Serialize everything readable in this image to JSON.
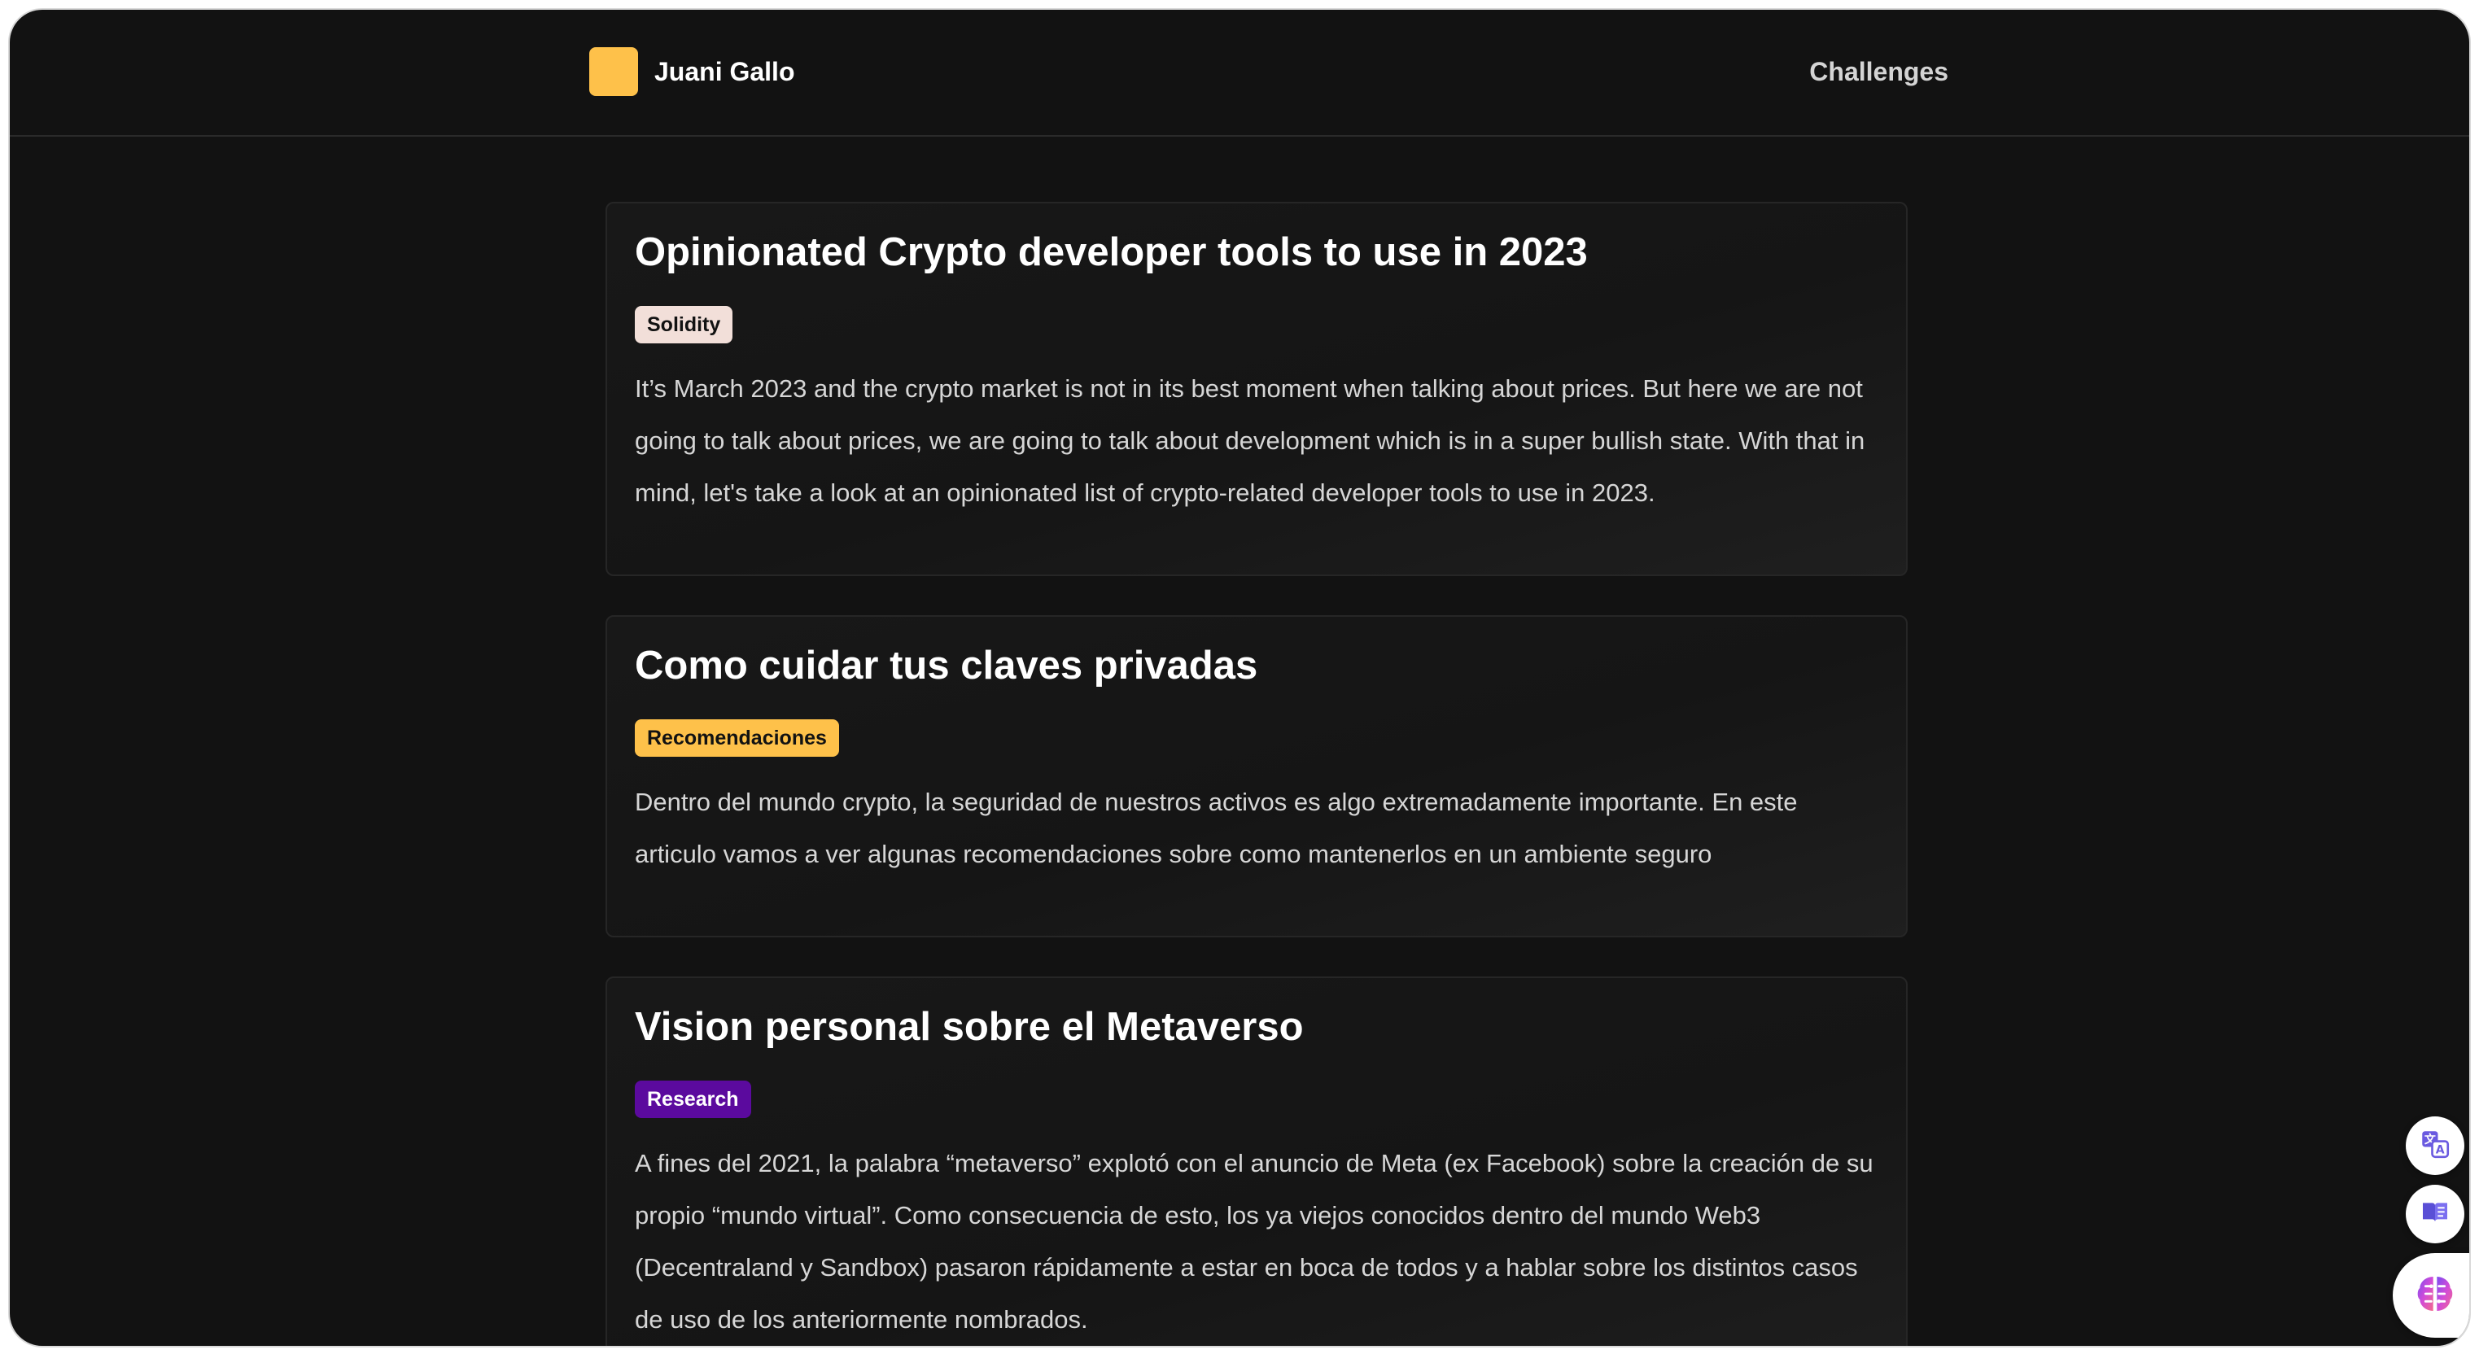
{
  "brand": {
    "name": "Juani Gallo",
    "logo_color": "#fec14a"
  },
  "nav": {
    "challenges_label": "Challenges"
  },
  "posts": [
    {
      "title": "Opinionated Crypto developer tools to use in 2023",
      "tag": "Solidity",
      "tag_bg": "#f2dfd9",
      "tag_fg": "#121212",
      "excerpt": "It’s March 2023 and the crypto market is not in its best moment when talking about prices. But here we are not going to talk about prices, we are going to talk about development which is in a super bullish state. With that in mind, let's take a look at an opinionated list of crypto-related developer tools to use in 2023."
    },
    {
      "title": "Como cuidar tus claves privadas",
      "tag": "Recomendaciones",
      "tag_bg": "#fec14a",
      "tag_fg": "#121212",
      "excerpt": "Dentro del mundo crypto, la seguridad de nuestros activos es algo extremadamente importante. En este articulo vamos a ver algunas recomendaciones sobre como mantenerlos en un ambiente seguro"
    },
    {
      "title": "Vision personal sobre el Metaverso",
      "tag": "Research",
      "tag_bg": "#5b0a9e",
      "tag_fg": "#ffffff",
      "excerpt": "A fines del 2021, la palabra “metaverso” explotó con el anuncio de Meta (ex Facebook) sobre la creación de su propio “mundo virtual”. Como consecuencia de esto, los ya viejos conocidos dentro del mundo Web3 (Decentraland y Sandbox) pasaron rápidamente a estar en boca de todos y a hablar sobre los distintos casos de uso de los anteriormente nombrados."
    }
  ],
  "floating_buttons": [
    {
      "icon": "translate-icon"
    },
    {
      "icon": "reader-mode-icon"
    },
    {
      "icon": "brain-ai-icon"
    }
  ]
}
